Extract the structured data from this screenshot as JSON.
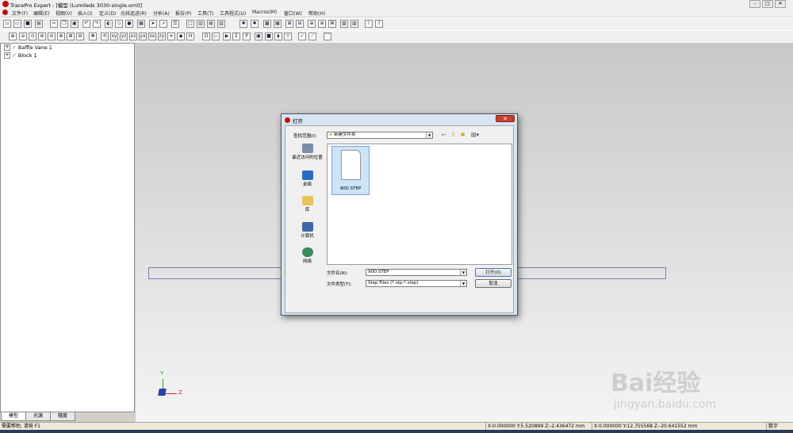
{
  "window": {
    "title": "TracePro Expert - [模型 (Lumileds 3030-single.oml)]",
    "min_glyph": "–",
    "max_glyph": "□",
    "close_glyph": "✕"
  },
  "menu": [
    "文件(F)",
    "编辑(E)",
    "视图(V)",
    "插入(I)",
    "定义(D)",
    "光线追迹(R)",
    "分析(A)",
    "报告(P)",
    "工具(T)",
    "工具程式(U)",
    "Macros(M)",
    "窗口(W)",
    "帮助(H)"
  ],
  "tree": {
    "items": [
      {
        "expander": "+",
        "label": "Baffle Vane 1"
      },
      {
        "expander": "+",
        "label": "Block 1"
      }
    ],
    "tabs": [
      "模型",
      "光源",
      "辐度"
    ]
  },
  "viewport": {
    "axis_y": "Y",
    "axis_z": "Z"
  },
  "status": {
    "help": "需要帮助, 请按 F1",
    "coord1": "X:0.000000 Y:5.520899 Z:-2.436472 mm",
    "coord2": "X:0.000000 Y:12.755568 Z:-20.641552 mm",
    "mode": "数字"
  },
  "dialog": {
    "title": "打开",
    "close_glyph": "✕",
    "lookin_label": "查找范围(I):",
    "lookin_value": "新建文件夹",
    "places": [
      "最近访问的位置",
      "桌面",
      "库",
      "计算机",
      "网络"
    ],
    "file": {
      "name": "90D.STEP"
    },
    "filename_label": "文件名(N):",
    "filename_value": "90D.STEP",
    "filetype_label": "文件类型(T):",
    "filetype_value": "Step Files (*.stp;*.step)",
    "open_button": "打开(O)",
    "cancel_button": "取消"
  },
  "watermark": {
    "brand": "Bai经验",
    "url": "jingyan.baidu.com"
  },
  "colors": {
    "accent_red": "#c01010",
    "check_green": "#1a9b1a",
    "selection_blue": "#cce4f7",
    "dialog_frame": "#d8e4f0"
  }
}
